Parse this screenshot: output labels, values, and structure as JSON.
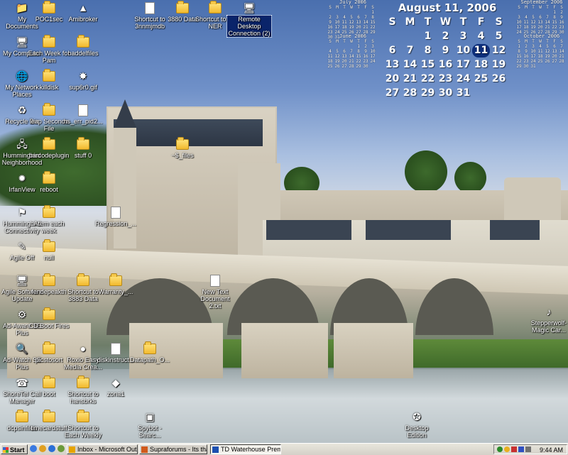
{
  "desktop": {
    "icons": [
      {
        "label": "My Documents",
        "glyph": "📁",
        "kind": "special"
      },
      {
        "label": "POC1sec",
        "kind": "folder"
      },
      {
        "label": "Amibroker",
        "glyph": "▲",
        "kind": "app"
      },
      {
        "label": "Shortcut to 3nnmjmdb",
        "kind": "doc"
      },
      {
        "label": "3880 Data",
        "kind": "folder"
      },
      {
        "label": "Shortcut to 51 NER",
        "kind": "folder"
      },
      {
        "label": "Remote Desktop Connection (2)",
        "glyph": "🖥",
        "kind": "app"
      },
      {
        "label": "My Computer",
        "glyph": "🖥",
        "kind": "special"
      },
      {
        "label": "Each Week for Pam",
        "kind": "folder"
      },
      {
        "label": "baddelfiles",
        "kind": "folder"
      },
      {
        "label": "My Network Places",
        "glyph": "🌐",
        "kind": "special"
      },
      {
        "label": "killdisk",
        "kind": "folder"
      },
      {
        "label": "sup6r0.gif",
        "glyph": "✸",
        "kind": "app"
      },
      {
        "label": "Recycle Bin",
        "glyph": "♻",
        "kind": "special"
      },
      {
        "label": "leap Seconds File",
        "kind": "folder"
      },
      {
        "label": "ns_err_pid2...",
        "kind": "doc"
      },
      {
        "label": "Hummingbird Neighborhood",
        "glyph": "🖧",
        "kind": "app"
      },
      {
        "label": "barcodeplugin",
        "kind": "folder"
      },
      {
        "label": "stuff 0",
        "kind": "folder"
      },
      {
        "label": "~$_files",
        "kind": "folder"
      },
      {
        "label": "IrfanView",
        "glyph": "✹",
        "kind": "app"
      },
      {
        "label": "reboot",
        "kind": "folder"
      },
      {
        "label": "Hummingbird Connectivity",
        "glyph": "⚑",
        "kind": "app"
      },
      {
        "label": "Atem each week",
        "kind": "folder"
      },
      {
        "label": "Regression_...",
        "kind": "doc"
      },
      {
        "label": "Agile Off",
        "glyph": "✎",
        "kind": "app"
      },
      {
        "label": "null",
        "kind": "folder"
      },
      {
        "label": "Agile Software Update",
        "glyph": "🖥",
        "kind": "app"
      },
      {
        "label": "fendepeakth",
        "kind": "folder"
      },
      {
        "label": "Shortcut to 3883 Data",
        "kind": "folder"
      },
      {
        "label": "Warranty_...",
        "kind": "folder"
      },
      {
        "label": "New Text Document 2.txt",
        "kind": "doc"
      },
      {
        "label": "Ad-Aware SE Plus",
        "glyph": "⚙",
        "kind": "app"
      },
      {
        "label": "CD Boot Fires",
        "kind": "folder"
      },
      {
        "label": "Ad-Watch SE Plus",
        "glyph": "🔍",
        "kind": "app"
      },
      {
        "label": "picstosort",
        "kind": "folder"
      },
      {
        "label": "Roxio Easy Media Crea...",
        "glyph": "●",
        "kind": "app"
      },
      {
        "label": "diskinstruct...",
        "kind": "doc"
      },
      {
        "label": "Datapath_O...",
        "kind": "folder"
      },
      {
        "label": "Stepperwolf-Magic Car...",
        "glyph": "♪",
        "kind": "app"
      },
      {
        "label": "ShoreTel Call Manager",
        "glyph": "☎",
        "kind": "app"
      },
      {
        "label": "boot",
        "kind": "folder"
      },
      {
        "label": "Shortcut to hansbrks",
        "kind": "folder"
      },
      {
        "label": "zona1",
        "glyph": "◆",
        "kind": "app"
      },
      {
        "label": "dcpsinfiles",
        "kind": "folder"
      },
      {
        "label": "timecardstuff",
        "kind": "folder"
      },
      {
        "label": "Shortcut to Each Weekly",
        "kind": "folder"
      },
      {
        "label": "Spybot - Searc...",
        "glyph": "▣",
        "kind": "app"
      },
      {
        "label": "Desktop Edition",
        "glyph": "✪",
        "kind": "app"
      }
    ]
  },
  "calendar": {
    "title": "August 11, 2006",
    "weekdays": [
      "S",
      "M",
      "T",
      "W",
      "T",
      "F",
      "S"
    ],
    "leading_blanks": 2,
    "days": [
      "1",
      "2",
      "3",
      "4",
      "5",
      "6",
      "7",
      "8",
      "9",
      "10",
      "11",
      "12",
      "13",
      "14",
      "15",
      "16",
      "17",
      "18",
      "19",
      "20",
      "21",
      "22",
      "23",
      "24",
      "25",
      "26",
      "27",
      "28",
      "29",
      "30",
      "31"
    ],
    "today": "11",
    "mini": [
      {
        "title": "July 2006",
        "blanks": 6,
        "count": 31
      },
      {
        "title": "June 2006",
        "blanks": 4,
        "count": 30
      },
      {
        "title": "September 2006",
        "blanks": 5,
        "count": 30
      },
      {
        "title": "October 2006",
        "blanks": 0,
        "count": 31
      }
    ],
    "mini_weekdays": "S M T W T F S"
  },
  "taskbar": {
    "start_label": "Start",
    "tasks": [
      {
        "label": "Inbox - Microsoft Outlook",
        "color": "#e6a400"
      },
      {
        "label": "Supraforums - Its that ti...",
        "color": "#d05a1c"
      },
      {
        "label": "TD Waterhouse Premier/...",
        "color": "#1c4fb0"
      }
    ],
    "clock": "9:44 AM"
  },
  "colors": {
    "today": "#0d2e7a",
    "taskbar": "#d4d0c8"
  }
}
